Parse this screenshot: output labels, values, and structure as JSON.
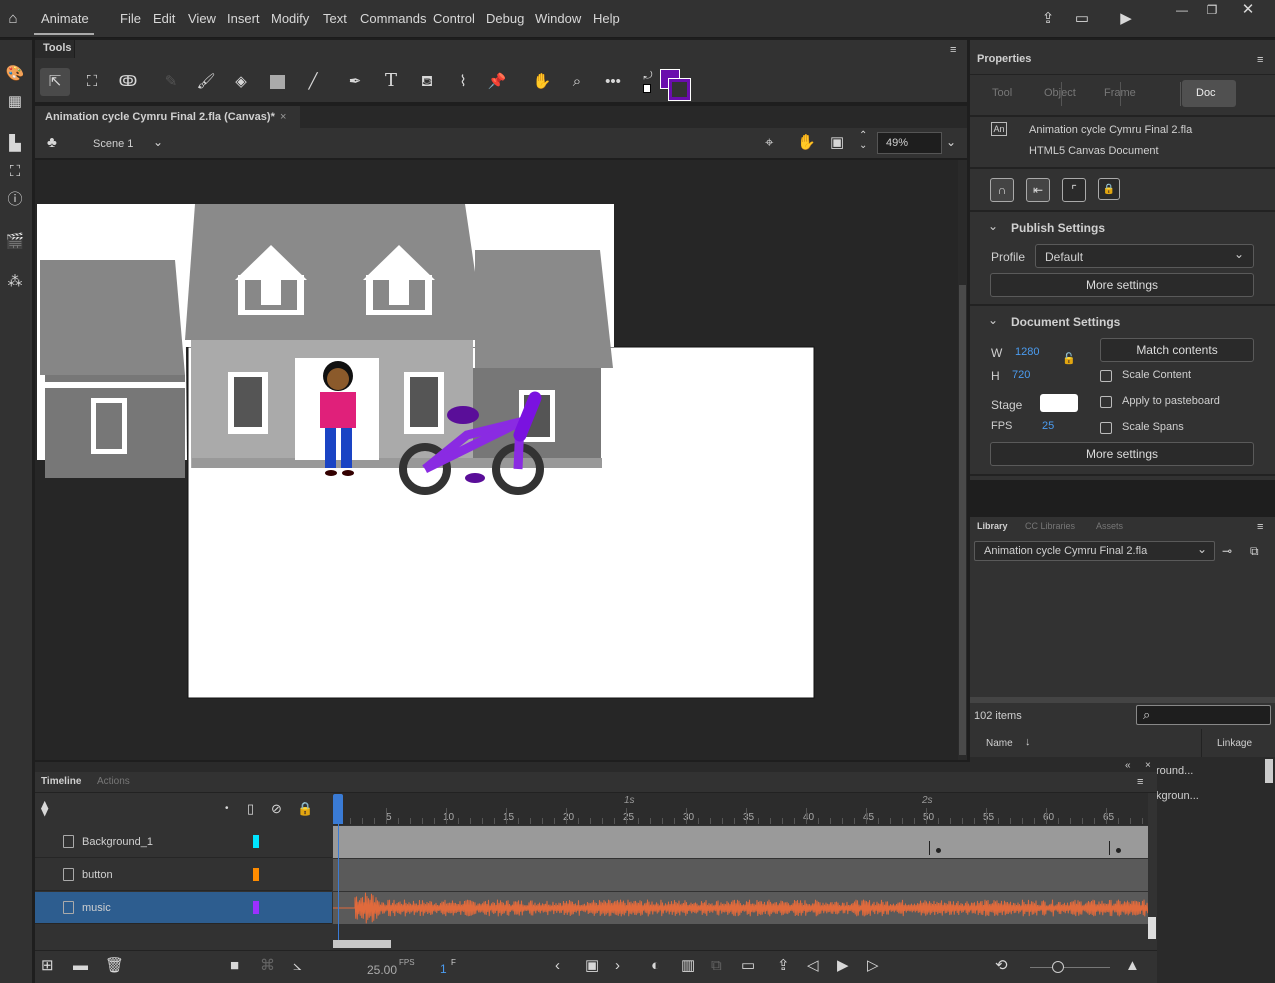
{
  "menu": {
    "app": "Animate",
    "items": [
      "File",
      "Edit",
      "View",
      "Insert",
      "Modify",
      "Text",
      "Commands",
      "Control",
      "Debug",
      "Window",
      "Help"
    ]
  },
  "tools": {
    "title": "Tools",
    "fill_color": "#6a0dad",
    "stroke_color": "#6a0dad"
  },
  "document": {
    "tab_title": "Animation cycle Cymru Final 2.fla (Canvas)*",
    "scene": "Scene 1",
    "zoom": "49%"
  },
  "properties": {
    "title": "Properties",
    "tabs": [
      "Tool",
      "Object",
      "Frame",
      "Doc"
    ],
    "active_tab": "Doc",
    "doc_badge": "An",
    "file_name": "Animation cycle Cymru Final 2.fla",
    "doc_type": "HTML5 Canvas Document",
    "publish": {
      "title": "Publish Settings",
      "profile_label": "Profile",
      "profile_value": "Default",
      "more": "More settings"
    },
    "docset": {
      "title": "Document Settings",
      "w_label": "W",
      "w": "1280",
      "h_label": "H",
      "h": "720",
      "match": "Match contents",
      "scale_content": "Scale Content",
      "apply_pasteboard": "Apply to pasteboard",
      "scale_spans": "Scale Spans",
      "stage_label": "Stage",
      "stage_color": "#ffffff",
      "fps_label": "FPS",
      "fps": "25",
      "more": "More settings"
    }
  },
  "library": {
    "tabs": [
      "Library",
      "CC Libraries",
      "Assets"
    ],
    "file": "Animation cycle Cymru Final 2.fla",
    "count": "102 items",
    "col_name": "Name",
    "col_linkage": "Linkage",
    "rows": [
      "round...",
      "kgroun..."
    ]
  },
  "timeline": {
    "tabs": [
      "Timeline",
      "Actions"
    ],
    "seconds": [
      "1s",
      "2s"
    ],
    "ticks": [
      "5",
      "10",
      "15",
      "20",
      "25",
      "30",
      "35",
      "40",
      "45",
      "50",
      "55",
      "60",
      "65"
    ],
    "layers": [
      {
        "name": "Background_1",
        "color": "#00e5ff"
      },
      {
        "name": "button",
        "color": "#ff8c00"
      },
      {
        "name": "music",
        "color": "#9b30ff",
        "selected": true
      }
    ],
    "fps": "25.00",
    "fps_unit": "FPS",
    "frame": "1",
    "frame_unit": "F",
    "wave_color": "#e06a3c"
  }
}
